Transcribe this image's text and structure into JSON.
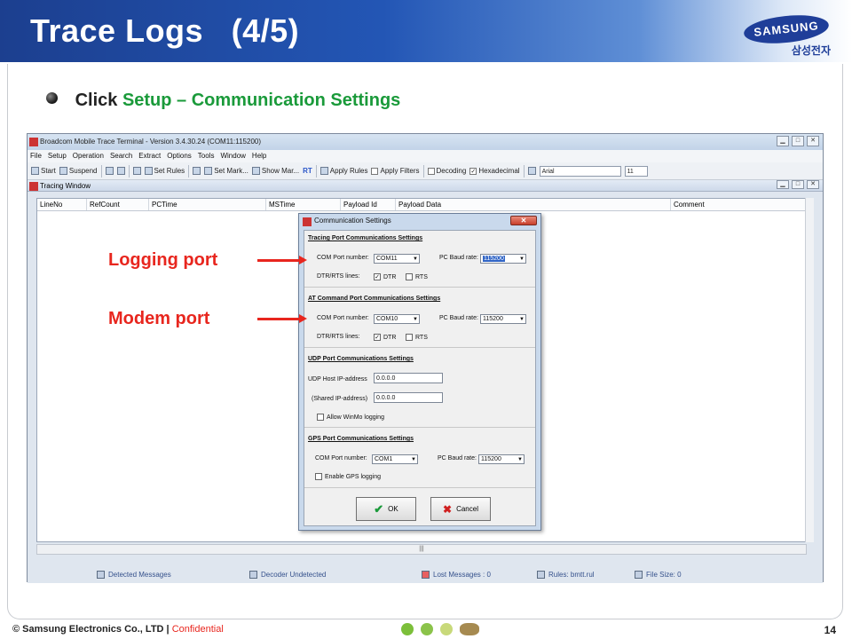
{
  "slide": {
    "title": "Trace Logs   (4/5)",
    "logo_text": "SAMSUNG",
    "logo_sub": "삼성전자",
    "bullet_prefix": "Click",
    "bullet_highlight": "Setup – Communication Settings"
  },
  "app": {
    "title": "Broadcom Mobile Trace Terminal - Version 3.4.30.24 (COM11:115200)",
    "menu": [
      "File",
      "Setup",
      "Operation",
      "Search",
      "Extract",
      "Options",
      "Tools",
      "Window",
      "Help"
    ],
    "toolbar": {
      "start": "Start",
      "suspend": "Suspend",
      "set_rules": "Set Rules",
      "set_mark": "Set Mark...",
      "show_mar": "Show Mar...",
      "rt": "RT",
      "apply_rules": "Apply Rules",
      "apply_filters": "Apply Filters",
      "decoding": "Decoding",
      "hexadecimal": "Hexadecimal",
      "font": "Arial",
      "font_size": "11"
    },
    "tracing_window_title": "Tracing Window",
    "columns": [
      "LineNo",
      "RefCount",
      "PCTime",
      "MSTime",
      "Payload Id",
      "Payload Data",
      "Comment"
    ],
    "status": {
      "detected_messages": "Detected Messages",
      "decoder": "Decoder Undetected",
      "lost_messages": "Lost Messages : 0",
      "rules": "Rules: bmtt.rul",
      "file_size": "File Size: 0"
    }
  },
  "dialog": {
    "title": "Communication Settings",
    "tracing": {
      "section_title": "Tracing Port Communications Settings",
      "com_label": "COM Port number:",
      "com_value": "COM11",
      "baud_label": "PC Baud rate:",
      "baud_value": "115200",
      "dtr_rts_label": "DTR/RTS lines:",
      "dtr": "DTR",
      "rts": "RTS"
    },
    "at_command": {
      "section_title": "AT Command Port Communications Settings",
      "com_label": "COM Port number:",
      "com_value": "COM10",
      "baud_label": "PC Baud rate:",
      "baud_value": "115200",
      "dtr_rts_label": "DTR/RTS lines:",
      "dtr": "DTR",
      "rts": "RTS"
    },
    "udp": {
      "section_title": "UDP Port Communications Settings",
      "host_label": "UDP Host IP-address",
      "host_value": "0.0.0.0",
      "shared_label": "(Shared IP-address)",
      "shared_value": "0.0.0.0",
      "winmo_label": "Allow WinMo logging"
    },
    "gps": {
      "section_title": "GPS Port Communications Settings",
      "com_label": "COM Port number:",
      "com_value": "COM1",
      "baud_label": "PC Baud rate:",
      "baud_value": "115200",
      "enable_label": "Enable GPS logging"
    },
    "ok": "OK",
    "cancel": "Cancel"
  },
  "annotations": {
    "logging_port": "Logging port",
    "modem_port": "Modem port"
  },
  "footer": {
    "copyright": "© Samsung Electronics Co., LTD  |",
    "confidential": "Confidential",
    "page": "14"
  },
  "colors": {
    "header_blue": "#2356b5",
    "highlight_green": "#1a9a3a",
    "annotation_red": "#e8261e"
  }
}
